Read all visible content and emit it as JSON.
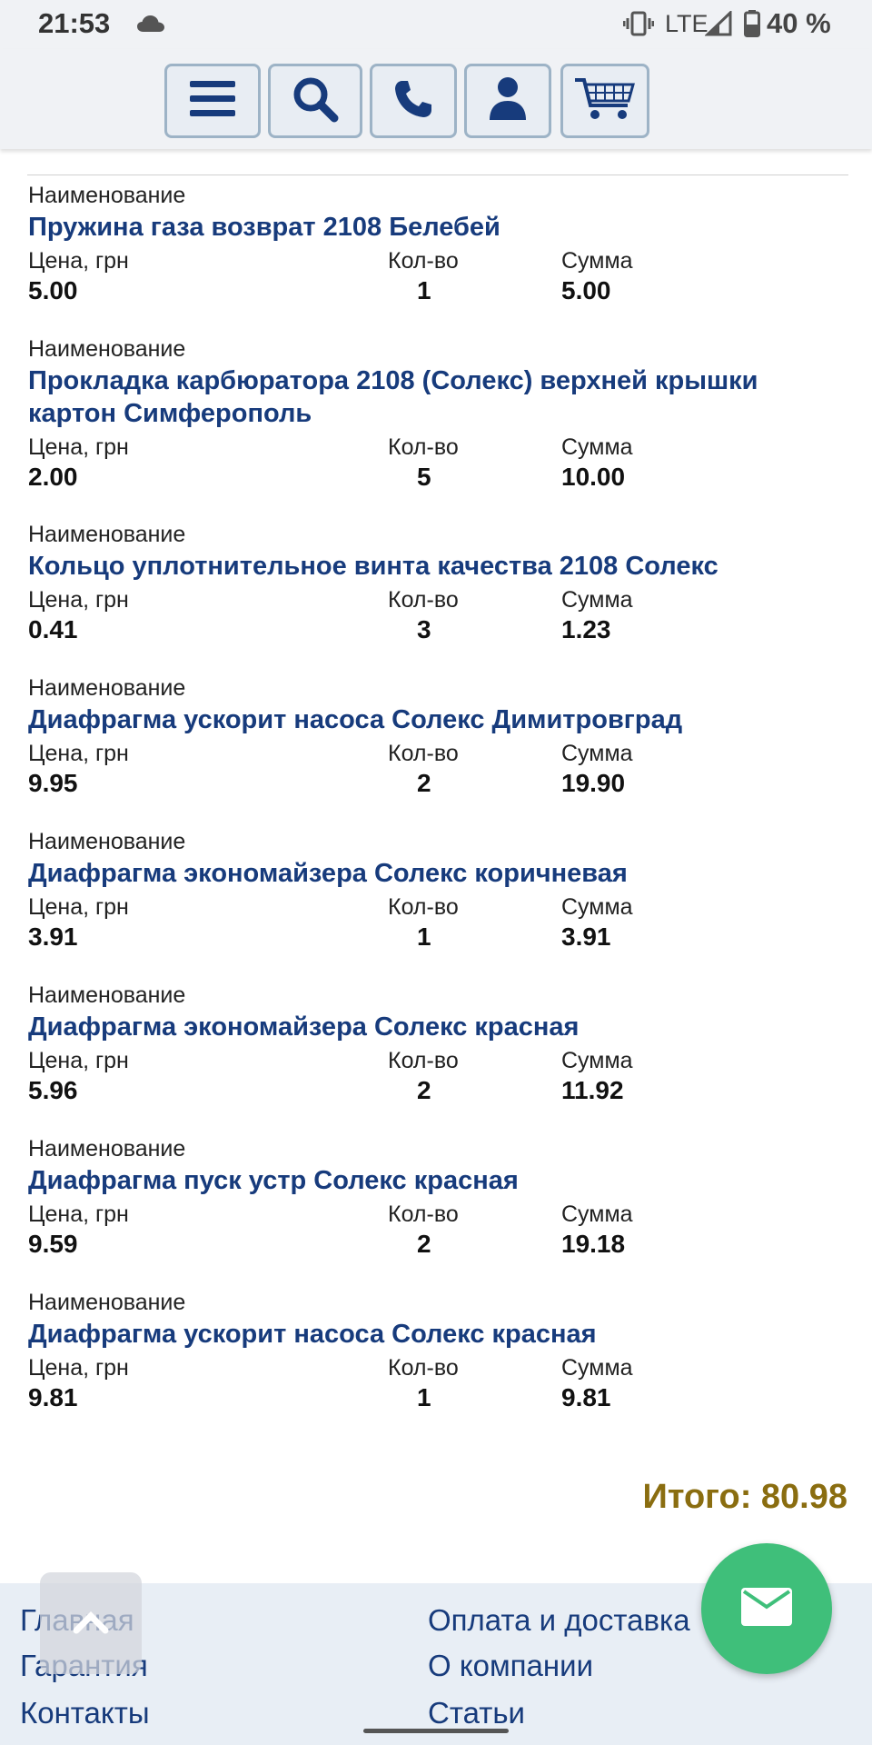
{
  "status_bar": {
    "time": "21:53",
    "network": "LTE",
    "battery": "40 %"
  },
  "header": {
    "buttons": [
      "menu-icon",
      "search-icon",
      "phone-icon",
      "user-icon",
      "cart-icon"
    ]
  },
  "labels": {
    "name": "Наименование",
    "price": "Цена, грн",
    "qty": "Кол-во",
    "sum": "Сумма"
  },
  "items": [
    {
      "name": "Пружина газа возврат 2108 Белебей",
      "price": "5.00",
      "qty": "1",
      "sum": "5.00"
    },
    {
      "name": "Прокладка карбюратора 2108 (Солекс) верхней крышки картон Симферополь",
      "price": "2.00",
      "qty": "5",
      "sum": "10.00"
    },
    {
      "name": "Кольцо уплотнительное винта качества 2108 Солекс",
      "price": "0.41",
      "qty": "3",
      "sum": "1.23"
    },
    {
      "name": "Диафрагма ускорит насоса Солекс Димитровград",
      "price": "9.95",
      "qty": "2",
      "sum": "19.90"
    },
    {
      "name": "Диафрагма экономайзера Солекс коричневая",
      "price": "3.91",
      "qty": "1",
      "sum": "3.91"
    },
    {
      "name": "Диафрагма экономайзера Солекс красная",
      "price": "5.96",
      "qty": "2",
      "sum": "11.92"
    },
    {
      "name": "Диафрагма пуск устр Солекс красная",
      "price": "9.59",
      "qty": "2",
      "sum": "19.18"
    },
    {
      "name": "Диафрагма ускорит насоса Солекс красная",
      "price": "9.81",
      "qty": "1",
      "sum": "9.81"
    }
  ],
  "total": "Итого: 80.98",
  "footer": {
    "left_links": [
      "Главная",
      "Гарантия",
      "Контакты"
    ],
    "right_links": [
      "Оплата и доставка",
      "О компании",
      "Статьи"
    ]
  },
  "colors": {
    "link": "#173b7c",
    "total": "#8a6d10",
    "fab": "#3fbf7a",
    "header_bg": "#f0f2f5",
    "footer_bg": "#e8eef5"
  }
}
